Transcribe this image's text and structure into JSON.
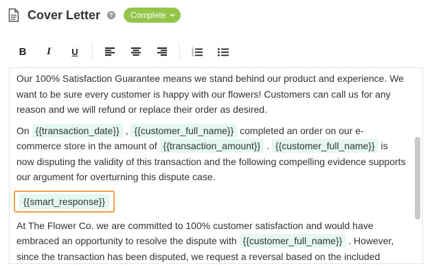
{
  "header": {
    "title": "Cover Letter",
    "help_icon": "question-circle-icon",
    "status": "Complete"
  },
  "toolbar": {
    "bold": "B",
    "italic": "I",
    "underline": "U",
    "buttons": [
      "bold",
      "italic",
      "underline",
      "align-left",
      "align-center",
      "align-right",
      "ordered-list",
      "bullet-list"
    ]
  },
  "editor": {
    "p1": "Our 100% Satisfaction Guarantee means we stand behind our product and experience. We want to be sure every customer is happy with our flowers! Customers can call us for any reason and we will refund or replace their order as desired.",
    "p2": {
      "t1": "On ",
      "tok1": "{{transaction_date}}",
      "t2": " , ",
      "tok2": "{{customer_full_name}}",
      "t3": " completed an order on our e-commerce store in the amount of ",
      "tok3": "{{transaction_amount}}",
      "t4": " . ",
      "tok4": "{{customer_full_name}}",
      "t5": " is now disputing the validity of this transaction and the following compelling evidence supports our argument for overturning this dispute case."
    },
    "smart_response": "{{smart_response}}",
    "p3": {
      "t1": "At The Flower Co. we are committed to 100% customer satisfaction and would have embraced an opportunity to resolve the dispute with ",
      "tok1": "{{customer_full_name}}",
      "t2": " . However, since the transaction has been disputed, we request a reversal based on the included"
    }
  },
  "colors": {
    "status_green": "#93c54b",
    "token_bg": "#e4f8ef",
    "highlight_orange": "#f0a04b"
  }
}
